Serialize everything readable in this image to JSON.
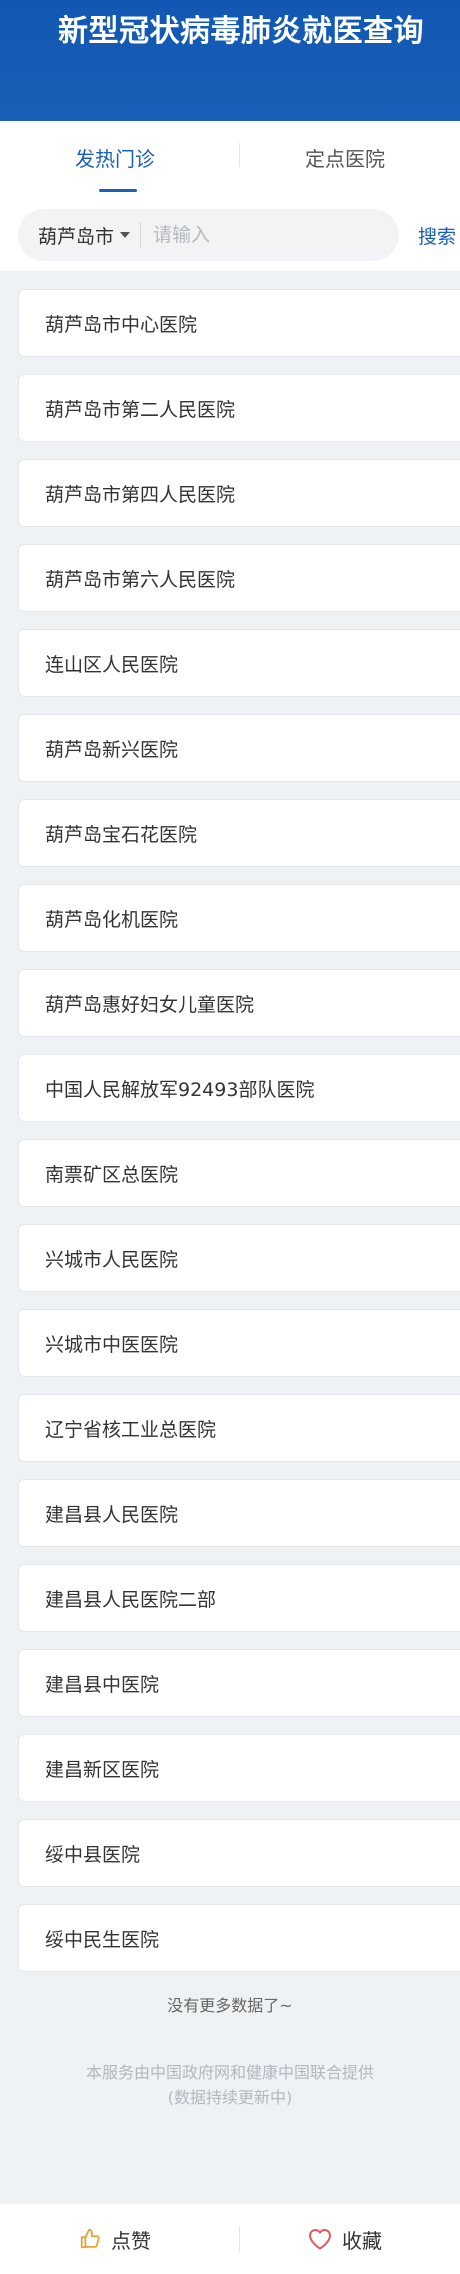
{
  "header": {
    "title": "新型冠状病毒肺炎就医查询"
  },
  "tabs": [
    {
      "label": "发热门诊"
    },
    {
      "label": "定点医院"
    }
  ],
  "search": {
    "city": "葫芦岛市",
    "placeholder": "请输入",
    "value": "",
    "button_label": "搜索"
  },
  "hospitals": [
    "葫芦岛市中心医院",
    "葫芦岛市第二人民医院",
    "葫芦岛市第四人民医院",
    "葫芦岛市第六人民医院",
    "连山区人民医院",
    "葫芦岛新兴医院",
    "葫芦岛宝石花医院",
    "葫芦岛化机医院",
    "葫芦岛惠好妇女儿童医院",
    "中国人民解放军92493部队医院",
    "南票矿区总医院",
    "兴城市人民医院",
    "兴城市中医医院",
    "辽宁省核工业总医院",
    "建昌县人民医院",
    "建昌县人民医院二部",
    "建昌县中医院",
    "建昌新区医院",
    "绥中县医院",
    "绥中民生医院"
  ],
  "list_end": "没有更多数据了~",
  "footer": {
    "line1": "本服务由中国政府网和健康中国联合提供",
    "line2": "(数据持续更新中)"
  },
  "bottom_bar": {
    "like_label": "点赞",
    "favorite_label": "收藏"
  },
  "colors": {
    "accent": "#1a5fb8",
    "background": "#eef2f5",
    "like_icon": "#e6a23c",
    "favorite_icon": "#e05a5a"
  }
}
